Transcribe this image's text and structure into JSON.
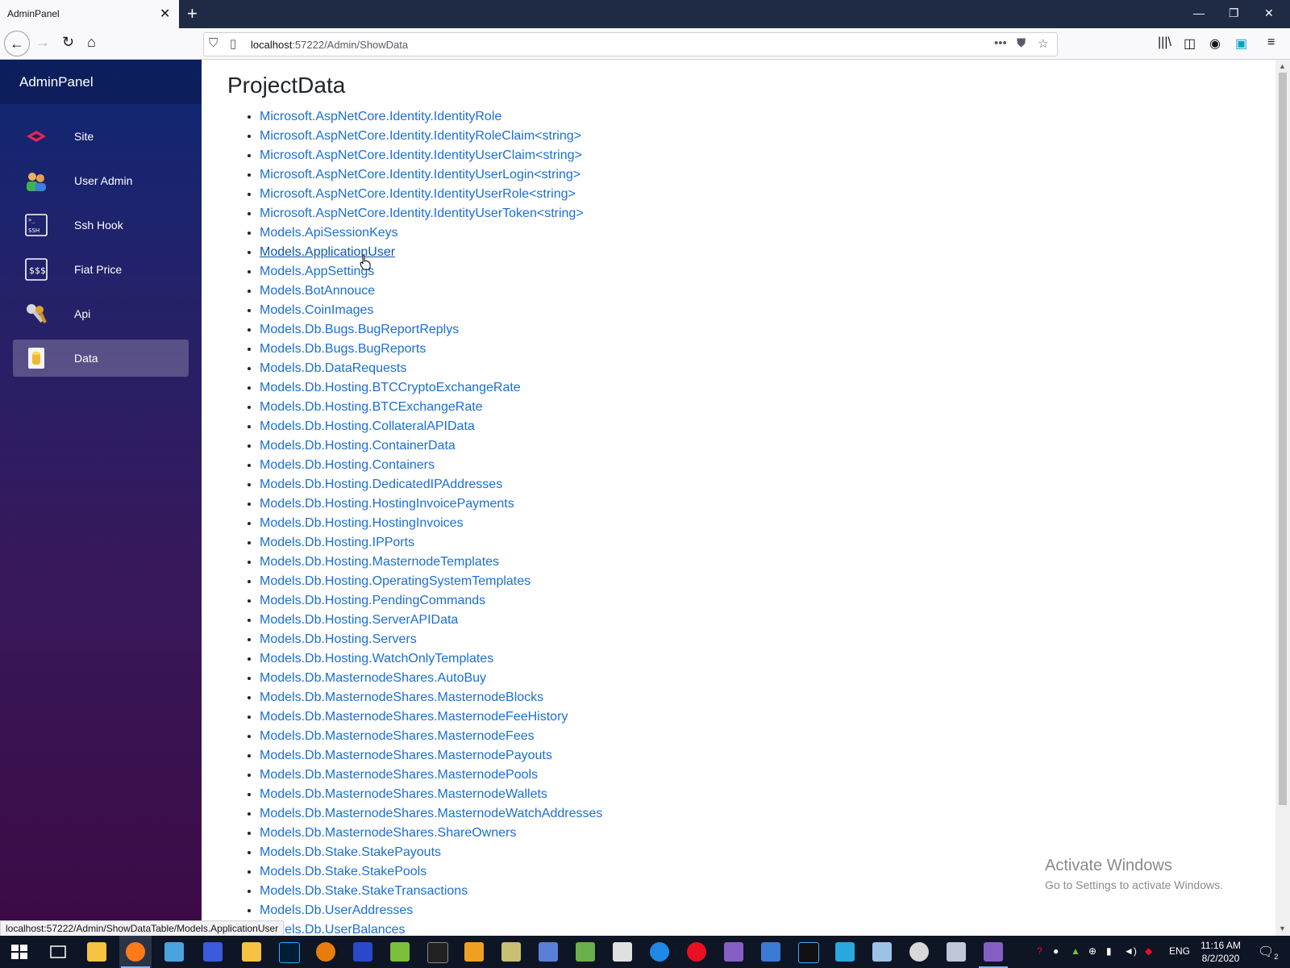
{
  "browser": {
    "tab_title": "AdminPanel",
    "url_host": "localhost",
    "url_path": ":57222/Admin/ShowData",
    "status_url": "localhost:57222/Admin/ShowDataTable/Models.ApplicationUser"
  },
  "sidebar": {
    "brand": "AdminPanel",
    "items": [
      {
        "label": "Site",
        "icon": "site-icon"
      },
      {
        "label": "User Admin",
        "icon": "users-icon"
      },
      {
        "label": "Ssh Hook",
        "icon": "ssh-terminal-icon"
      },
      {
        "label": "Fiat Price",
        "icon": "money-icon"
      },
      {
        "label": "Api",
        "icon": "keys-icon"
      },
      {
        "label": "Data",
        "icon": "database-icon",
        "active": true
      }
    ]
  },
  "main": {
    "title": "ProjectData",
    "links": [
      "Microsoft.AspNetCore.Identity.IdentityRole",
      "Microsoft.AspNetCore.Identity.IdentityRoleClaim<string>",
      "Microsoft.AspNetCore.Identity.IdentityUserClaim<string>",
      "Microsoft.AspNetCore.Identity.IdentityUserLogin<string>",
      "Microsoft.AspNetCore.Identity.IdentityUserRole<string>",
      "Microsoft.AspNetCore.Identity.IdentityUserToken<string>",
      "Models.ApiSessionKeys",
      "Models.ApplicationUser",
      "Models.AppSettings",
      "Models.BotAnnouce",
      "Models.CoinImages",
      "Models.Db.Bugs.BugReportReplys",
      "Models.Db.Bugs.BugReports",
      "Models.Db.DataRequests",
      "Models.Db.Hosting.BTCCryptoExchangeRate",
      "Models.Db.Hosting.BTCExchangeRate",
      "Models.Db.Hosting.CollateralAPIData",
      "Models.Db.Hosting.ContainerData",
      "Models.Db.Hosting.Containers",
      "Models.Db.Hosting.DedicatedIPAddresses",
      "Models.Db.Hosting.HostingInvoicePayments",
      "Models.Db.Hosting.HostingInvoices",
      "Models.Db.Hosting.IPPorts",
      "Models.Db.Hosting.MasternodeTemplates",
      "Models.Db.Hosting.OperatingSystemTemplates",
      "Models.Db.Hosting.PendingCommands",
      "Models.Db.Hosting.ServerAPIData",
      "Models.Db.Hosting.Servers",
      "Models.Db.Hosting.WatchOnlyTemplates",
      "Models.Db.MasternodeShares.AutoBuy",
      "Models.Db.MasternodeShares.MasternodeBlocks",
      "Models.Db.MasternodeShares.MasternodeFeeHistory",
      "Models.Db.MasternodeShares.MasternodeFees",
      "Models.Db.MasternodeShares.MasternodePayouts",
      "Models.Db.MasternodeShares.MasternodePools",
      "Models.Db.MasternodeShares.MasternodeWallets",
      "Models.Db.MasternodeShares.MasternodeWatchAddresses",
      "Models.Db.MasternodeShares.ShareOwners",
      "Models.Db.Stake.StakePayouts",
      "Models.Db.Stake.StakePools",
      "Models.Db.Stake.StakeTransactions",
      "Models.Db.UserAddresses",
      "Models.Db.UserBalances"
    ],
    "hovered_link": "Models.ApplicationUser"
  },
  "watermark": {
    "title": "Activate Windows",
    "subtitle": "Go to Settings to activate Windows."
  },
  "taskbar": {
    "language": "ENG",
    "time": "11:16 AM",
    "date": "8/2/2020",
    "notification_count": "2"
  },
  "colors": {
    "link": "#1a6ed8",
    "sidebar_top": "#0f2774",
    "sidebar_bottom": "#3c0a45"
  }
}
